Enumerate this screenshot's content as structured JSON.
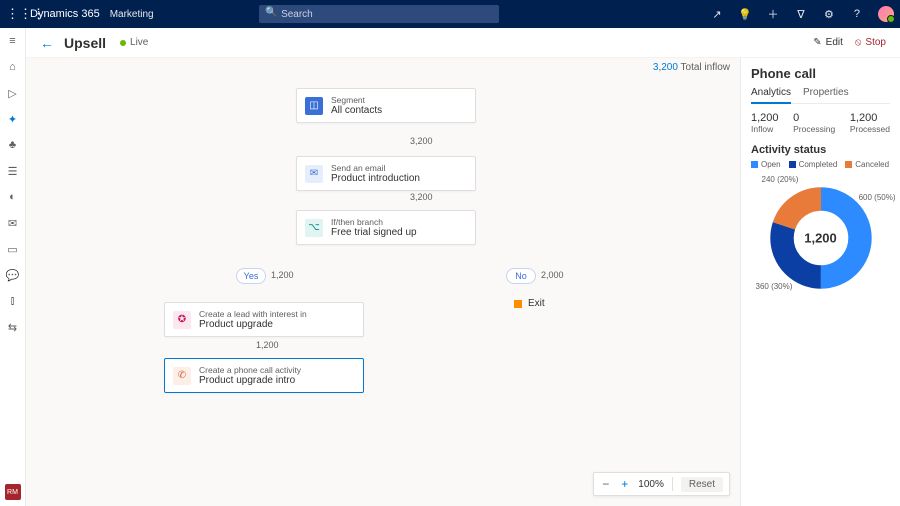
{
  "topbar": {
    "app": "Dynamics 365",
    "module": "Marketing",
    "search_placeholder": "Search"
  },
  "header": {
    "title": "Upsell",
    "status": "Live",
    "edit": "Edit",
    "stop": "Stop"
  },
  "canvas": {
    "inflow_value": "3,200",
    "inflow_label": "Total inflow",
    "nodes": {
      "segment": {
        "type": "Segment",
        "label": "All contacts"
      },
      "email": {
        "type": "Send an email",
        "label": "Product introduction"
      },
      "branch": {
        "type": "If/then branch",
        "label": "Free trial signed up"
      },
      "lead": {
        "type": "Create a lead with interest in",
        "label": "Product upgrade"
      },
      "phone": {
        "type": "Create a phone call activity",
        "label": "Product upgrade intro"
      }
    },
    "edges": {
      "seg_email": "3,200",
      "email_branch": "3,200",
      "yes": "Yes",
      "yes_count": "1,200",
      "no": "No",
      "no_count": "2,000",
      "lead_phone": "1,200"
    },
    "exit": "Exit"
  },
  "panel": {
    "title": "Phone call",
    "tabs": {
      "analytics": "Analytics",
      "properties": "Properties"
    },
    "stats": [
      {
        "v": "1,200",
        "l": "Inflow"
      },
      {
        "v": "0",
        "l": "Processing"
      },
      {
        "v": "1,200",
        "l": "Processed"
      }
    ],
    "activity_title": "Activity status",
    "legend": {
      "open": "Open",
      "completed": "Completed",
      "canceled": "Canceled"
    },
    "donut": {
      "center": "1,200",
      "labels": {
        "top": "240 (20%)",
        "right": "600 (50%)",
        "bottom": "360 (30%)"
      }
    }
  },
  "zoom": {
    "level": "100%",
    "reset": "Reset"
  },
  "rail_badge": "RM",
  "chart_data": {
    "type": "pie",
    "title": "Activity status",
    "series": [
      {
        "name": "Open",
        "value": 600,
        "pct": 50,
        "color": "#2e8bff"
      },
      {
        "name": "Completed",
        "value": 360,
        "pct": 30,
        "color": "#0b3fa3"
      },
      {
        "name": "Canceled",
        "value": 240,
        "pct": 20,
        "color": "#e87b3a"
      }
    ],
    "total": 1200
  }
}
